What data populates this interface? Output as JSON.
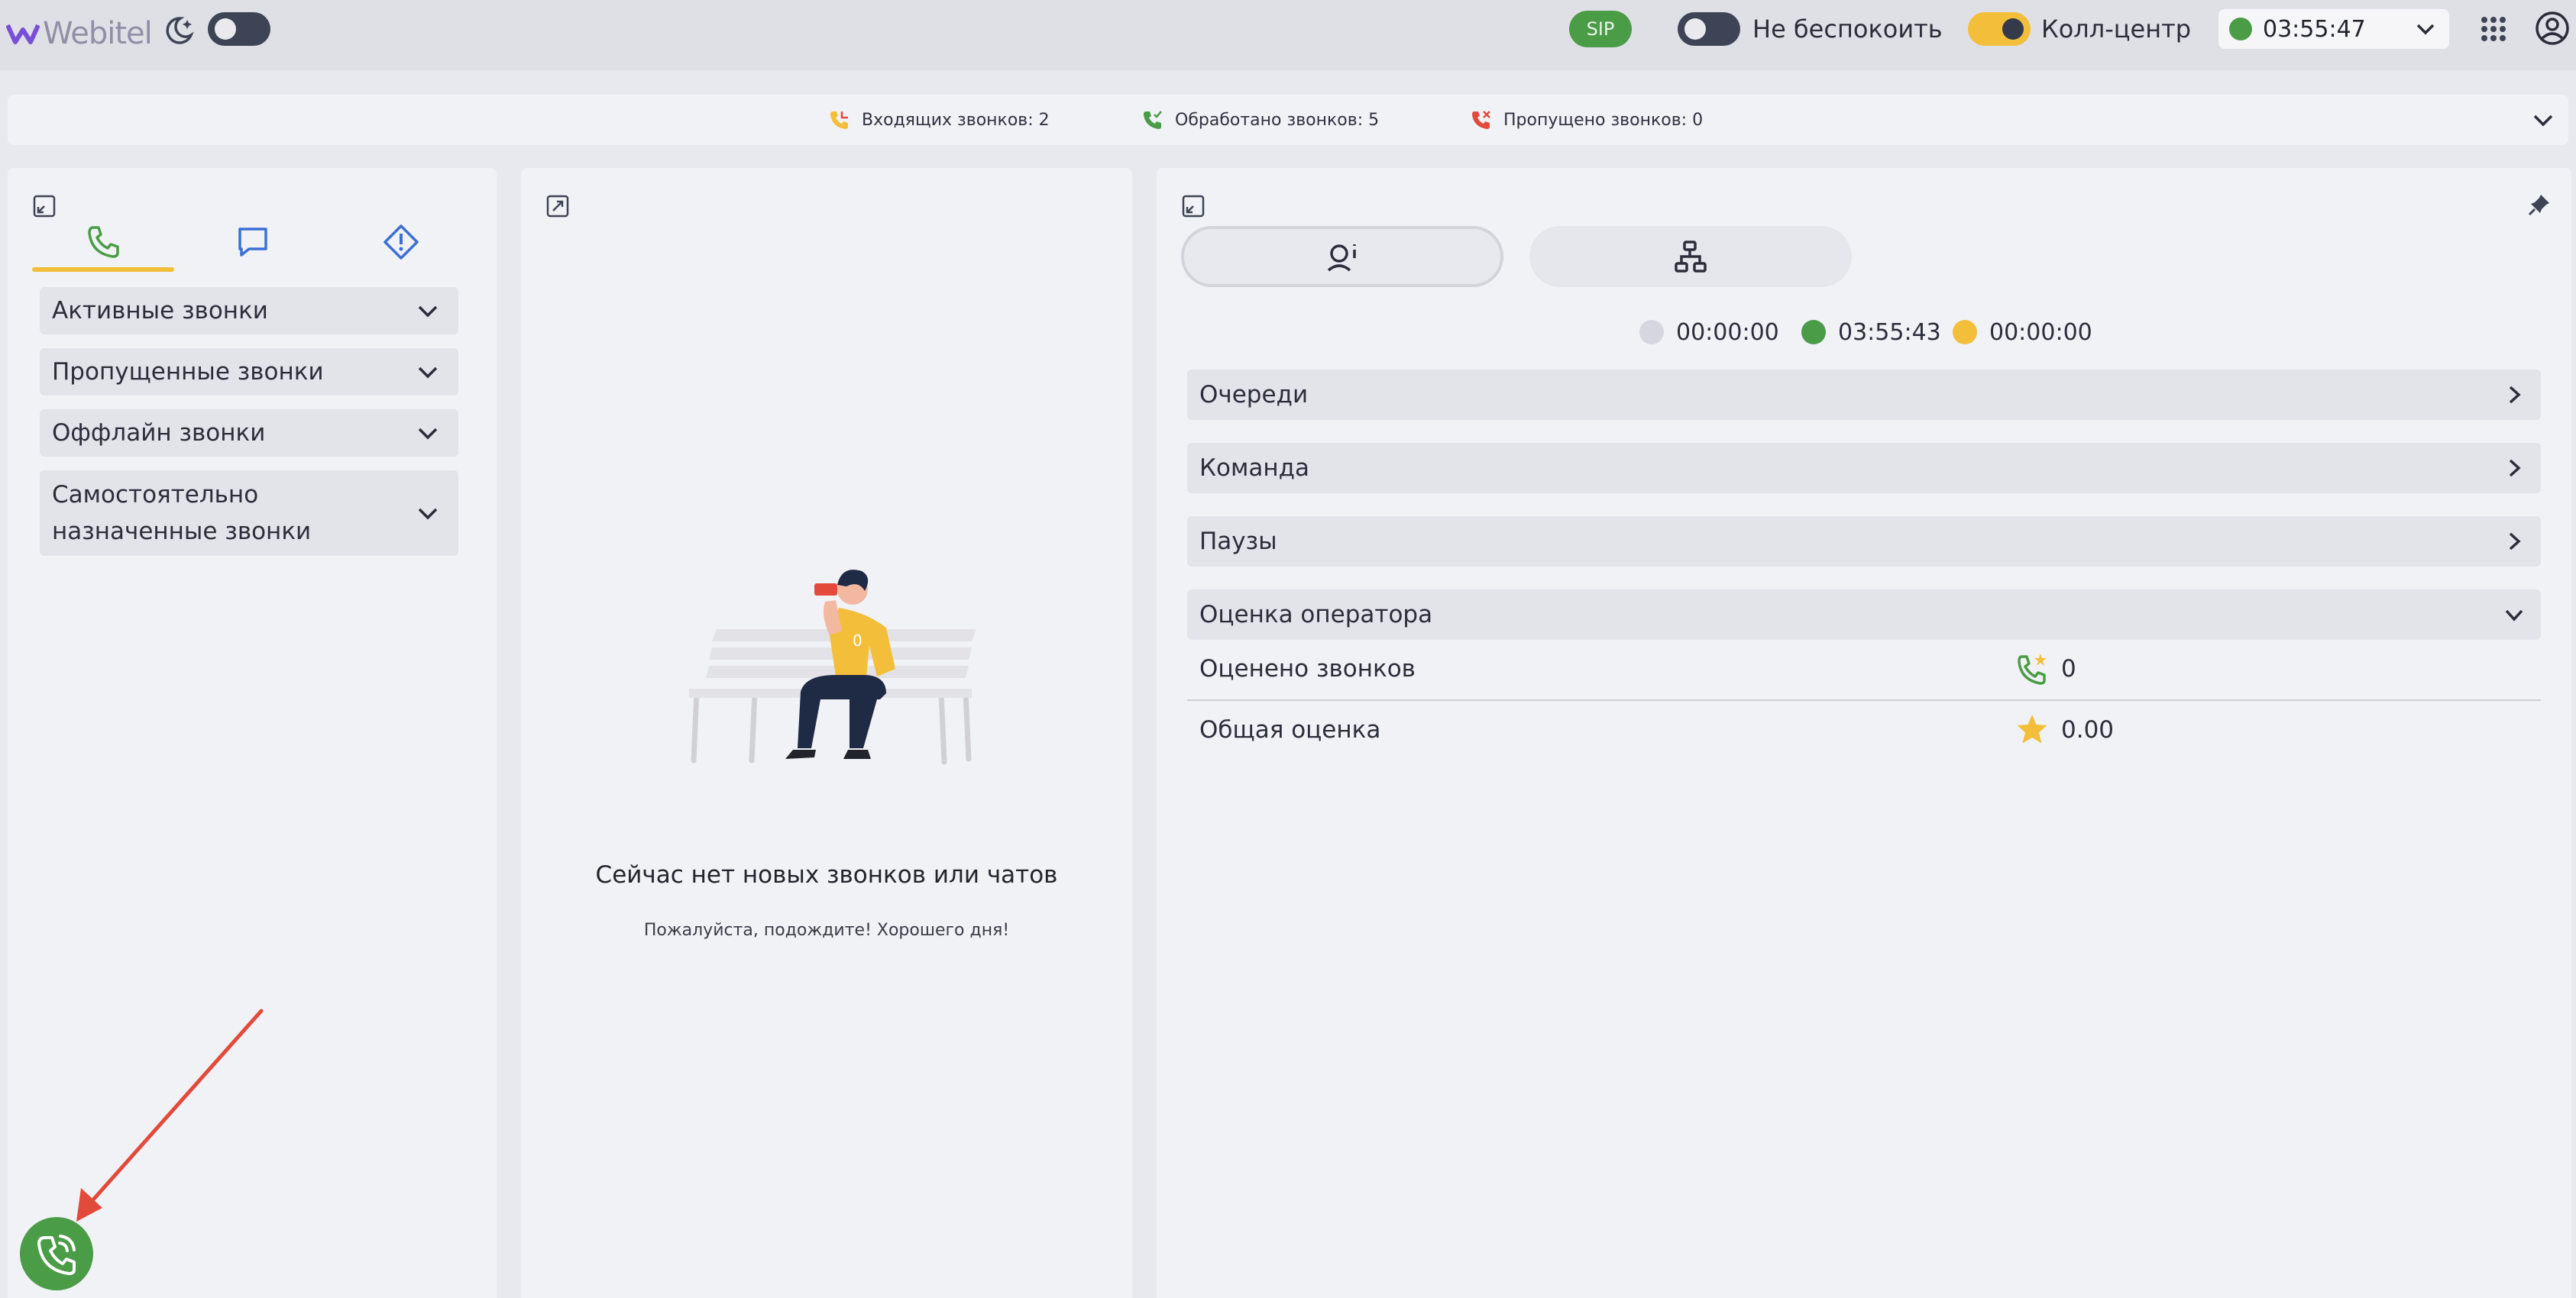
{
  "header": {
    "brand": "Webitel",
    "sip_label": "SIP",
    "dnd_label": "Не беспокоить",
    "callcenter_label": "Колл-центр",
    "status_time": "03:55:47",
    "status_color": "#4a9c47"
  },
  "stats": {
    "incoming": "Входящих звонков: 2",
    "handled": "Обработано звонков: 5",
    "missed": "Пропущено звонков: 0"
  },
  "left": {
    "tabs": [
      "phone-icon",
      "chat-icon",
      "alert-icon"
    ],
    "sections": [
      {
        "label": "Активные звонки"
      },
      {
        "label": "Пропущенные звонки"
      },
      {
        "label": "Оффлайн звонки"
      },
      {
        "label": "Самостоятельно назначенные звонки"
      }
    ]
  },
  "middle": {
    "empty_title": "Сейчас нет новых звонков или чатов",
    "empty_subtitle": "Пожалуйста, подождите! Хорошего дня!"
  },
  "right": {
    "timers": [
      {
        "value": "00:00:00",
        "color": "#d6d7de"
      },
      {
        "value": "03:55:43",
        "color": "#4a9c47"
      },
      {
        "value": "00:00:00",
        "color": "#f3bf3a"
      }
    ],
    "sections": [
      {
        "label": "Очереди"
      },
      {
        "label": "Команда"
      },
      {
        "label": "Паузы"
      },
      {
        "label": "Оценка оператора"
      }
    ],
    "rating": {
      "rated_label": "Оценено звонков",
      "rated_value": "0",
      "overall_label": "Общая оценка",
      "overall_value": "0.00"
    }
  },
  "colors": {
    "accent": "#f3bf3a",
    "green": "#4a9c47",
    "blue": "#3b6fd6",
    "red": "#e24a3b"
  }
}
